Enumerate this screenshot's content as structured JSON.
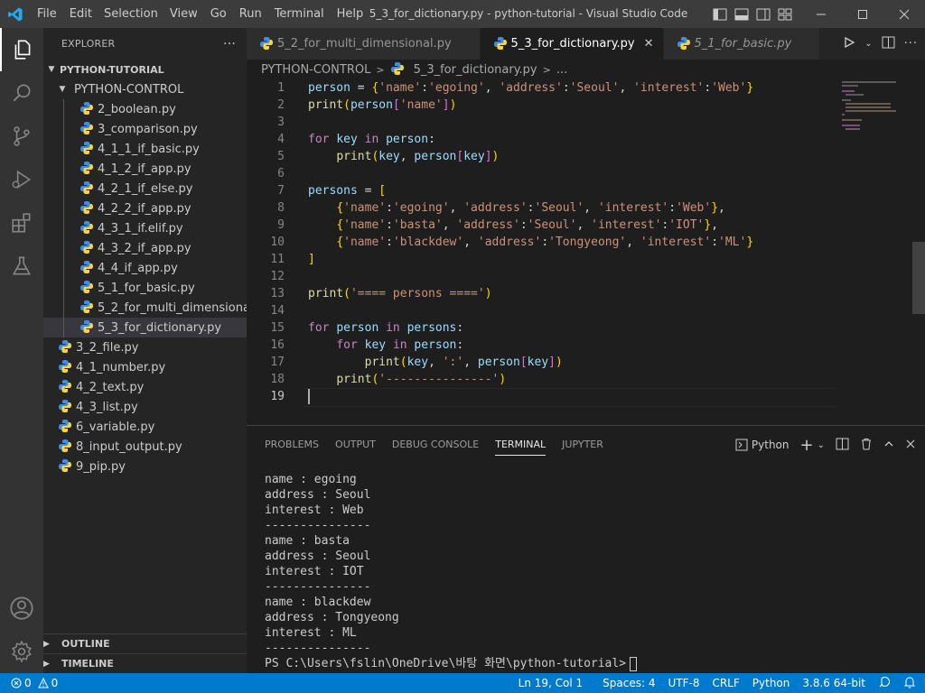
{
  "window": {
    "title": "5_3_for_dictionary.py - python-tutorial - Visual Studio Code",
    "menus": [
      "File",
      "Edit",
      "Selection",
      "View",
      "Go",
      "Run",
      "Terminal",
      "Help"
    ]
  },
  "sidebar": {
    "title": "EXPLORER",
    "more": "···",
    "root": "PYTHON-TUTORIAL",
    "folder": "PYTHON-CONTROL",
    "folder_files": [
      "2_boolean.py",
      "3_comparison.py",
      "4_1_1_if_basic.py",
      "4_1_2_if_app.py",
      "4_2_1_if_else.py",
      "4_2_2_if_app.py",
      "4_3_1_if.elif.py",
      "4_3_2_if_app.py",
      "4_4_if_app.py",
      "5_1_for_basic.py",
      "5_2_for_multi_dimensional.py",
      "5_3_for_dictionary.py"
    ],
    "root_files": [
      "3_2_file.py",
      "4_1_number.py",
      "4_2_text.py",
      "4_3_list.py",
      "6_variable.py",
      "8_input_output.py",
      "9_pip.py"
    ],
    "selected_file": "5_3_for_dictionary.py",
    "outline": "OUTLINE",
    "timeline": "TIMELINE"
  },
  "tabs": [
    {
      "label": "5_2_for_multi_dimensional.py",
      "state": "inactive"
    },
    {
      "label": "5_3_for_dictionary.py",
      "state": "active"
    },
    {
      "label": "5_1_for_basic.py",
      "state": "preview"
    }
  ],
  "tab_close": "✕",
  "breadcrumb": {
    "folder": "PYTHON-CONTROL",
    "file": "5_3_for_dictionary.py",
    "rest": "..."
  },
  "editor": {
    "current_line": 19,
    "lines": [
      "person = {'name':'egoing', 'address':'Seoul', 'interest':'Web'}",
      "print(person['name'])",
      "",
      "for key in person:",
      "    print(key, person[key])",
      "",
      "persons = [",
      "    {'name':'egoing', 'address':'Seoul', 'interest':'Web'},",
      "    {'name':'basta', 'address':'Seoul', 'interest':'IOT'},",
      "    {'name':'blackdew', 'address':'Tongyeong', 'interest':'ML'}",
      "]",
      "",
      "print('==== persons ====')",
      "",
      "for person in persons:",
      "    for key in person:",
      "        print(key, ':', person[key])",
      "    print('---------------')",
      ""
    ]
  },
  "panel": {
    "tabs": [
      "PROBLEMS",
      "OUTPUT",
      "DEBUG CONSOLE",
      "TERMINAL",
      "JUPYTER"
    ],
    "active_tab": "TERMINAL",
    "terminal_kind": "Python",
    "terminal_lines": [
      "name : egoing",
      "address : Seoul",
      "interest : Web",
      "---------------",
      "name : basta",
      "address : Seoul",
      "interest : IOT",
      "---------------",
      "name : blackdew",
      "address : Tongyeong",
      "interest : ML",
      "---------------"
    ],
    "prompt": "PS C:\\Users\\fslin\\OneDrive\\바탕 화면\\python-tutorial>"
  },
  "status": {
    "errors": "0",
    "warnings": "0",
    "position": "Ln 19, Col 1",
    "spaces": "Spaces: 4",
    "encoding": "UTF-8",
    "eol": "CRLF",
    "language": "Python",
    "interpreter": "3.8.6 64-bit"
  },
  "colors": {
    "accent": "#007acc",
    "python_icon_blue": "#3b8eea",
    "python_icon_yellow": "#ffd43b",
    "vscode_blue": "#23a9f2"
  },
  "icons": {
    "activity": [
      "explorer-icon",
      "search-icon",
      "source-control-icon",
      "run-debug-icon",
      "extensions-icon",
      "testing-icon",
      "account-icon",
      "settings-gear-icon"
    ]
  }
}
